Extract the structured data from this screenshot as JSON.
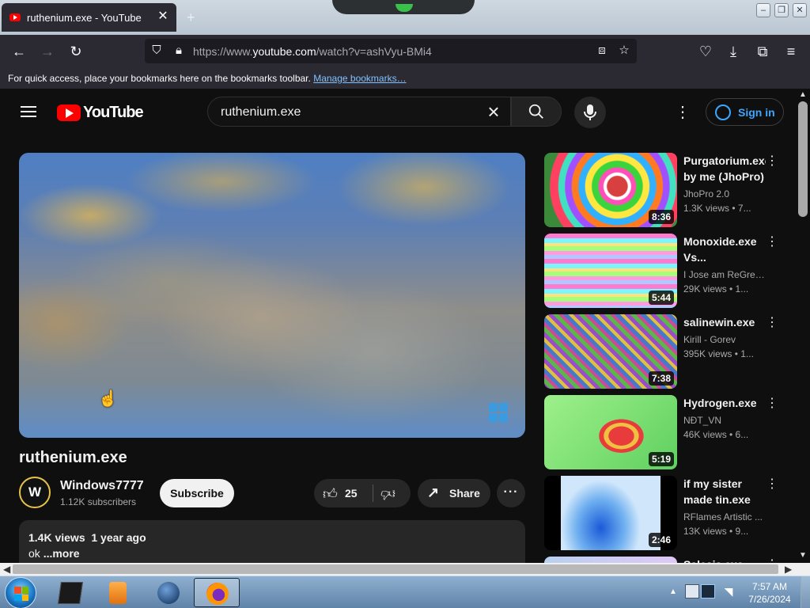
{
  "browser": {
    "tab_title": "ruthenium.exe - YouTube",
    "url_prefix": "https://www.",
    "url_host": "youtube.com",
    "url_path": "/watch?v=ashVyu-BMi4",
    "bookmarks_message": "For quick access, place your bookmarks here on the bookmarks toolbar.",
    "bookmarks_link": "Manage bookmarks…"
  },
  "youtube": {
    "logo_text": "YouTube",
    "search_query": "ruthenium.exe",
    "sign_in_label": "Sign in",
    "video": {
      "title": "ruthenium.exe",
      "channel_initial": "W",
      "channel_name": "Windows7777",
      "subscribers": "1.12K subscribers",
      "subscribe_label": "Subscribe",
      "likes": "25",
      "share_label": "Share",
      "views_and_date": "1.4K views  1 year ago",
      "description": "ok",
      "more_label": "...more"
    },
    "recommendations": [
      {
        "title": "Purgatorium.exe by me (JhoPro)",
        "channel": "JhoPro 2.0",
        "meta": "1.3K views  • 7...",
        "duration": "8:36"
      },
      {
        "title": "Monoxide.exe Vs...",
        "channel": "I Jose am ReGret...",
        "meta": "29K views  • 1...",
        "duration": "5:44"
      },
      {
        "title": "salinewin.exe",
        "channel": "Kirill - Gorev",
        "meta": "395K views  • 1...",
        "duration": "7:38"
      },
      {
        "title": "Hydrogen.exe",
        "channel": "NĐT_VN",
        "meta": "46K views  • 6...",
        "duration": "5:19"
      },
      {
        "title": "if my sister made tin.exe",
        "channel": "RFlames Artistic ...",
        "meta": "13K views  • 9...",
        "duration": "2:46"
      },
      {
        "title": "Salesia.exe",
        "channel": "",
        "meta": "",
        "duration": ""
      }
    ]
  },
  "taskbar": {
    "time": "7:57 AM",
    "date": "7/26/2024"
  },
  "colors": {
    "yt_bg": "#0f0f0f",
    "yt_red": "#ff0000",
    "link_blue": "#3ea6ff",
    "firefox_chrome": "#2b2a33"
  }
}
